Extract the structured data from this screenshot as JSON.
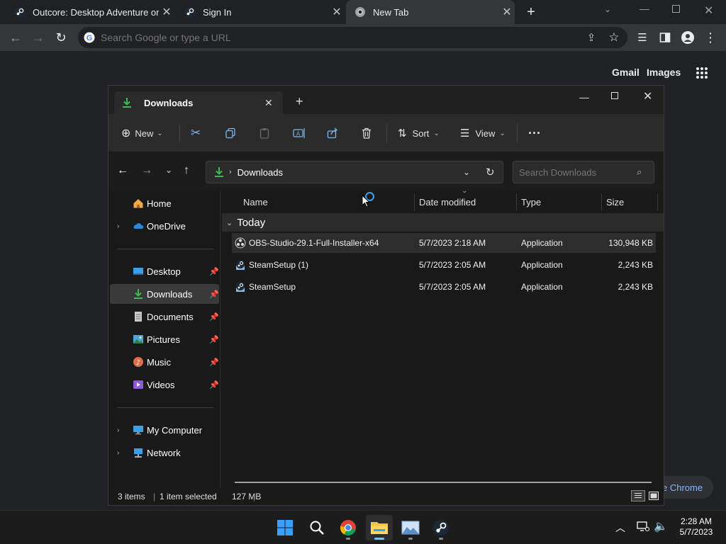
{
  "chrome": {
    "tabs": [
      {
        "title": "Outcore: Desktop Adventure on S",
        "icon": "steam-icon"
      },
      {
        "title": "Sign In",
        "icon": "steam-icon"
      },
      {
        "title": "New Tab",
        "icon": "chrome-icon"
      }
    ],
    "omnibox_placeholder": "Search Google or type a URL",
    "newtab": {
      "gmail": "Gmail",
      "images": "Images",
      "customize": "e Chrome"
    }
  },
  "explorer": {
    "tab_title": "Downloads",
    "cmdbar": {
      "new_label": "New",
      "sort_label": "Sort",
      "view_label": "View"
    },
    "address": "Downloads",
    "search_placeholder": "Search Downloads",
    "nav": {
      "home": "Home",
      "onedrive": "OneDrive",
      "desktop": "Desktop",
      "downloads": "Downloads",
      "documents": "Documents",
      "pictures": "Pictures",
      "music": "Music",
      "videos": "Videos",
      "mycomputer": "My Computer",
      "network": "Network"
    },
    "columns": {
      "name": "Name",
      "date": "Date modified",
      "type": "Type",
      "size": "Size"
    },
    "group": "Today",
    "files": [
      {
        "name": "OBS-Studio-29.1-Full-Installer-x64",
        "date": "5/7/2023 2:18 AM",
        "type": "Application",
        "size": "130,948 KB"
      },
      {
        "name": "SteamSetup (1)",
        "date": "5/7/2023 2:05 AM",
        "type": "Application",
        "size": "2,243 KB"
      },
      {
        "name": "SteamSetup",
        "date": "5/7/2023 2:05 AM",
        "type": "Application",
        "size": "2,243 KB"
      }
    ],
    "status": {
      "items": "3 items",
      "selected": "1 item selected",
      "size": "127 MB"
    }
  },
  "taskbar": {
    "time": "2:28 AM",
    "date": "5/7/2023"
  },
  "colors": {
    "accent": "#60cdff",
    "download_green": "#3fb950",
    "chrome_bg": "#202124"
  }
}
